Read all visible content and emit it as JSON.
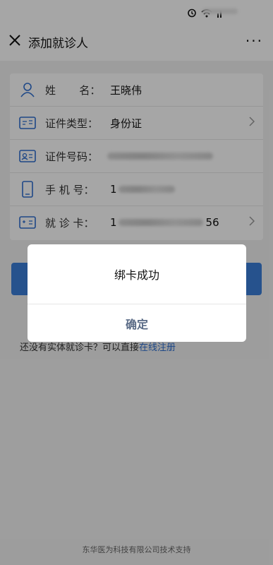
{
  "nav": {
    "title": "添加就诊人",
    "more": "···"
  },
  "form": {
    "name_label": "姓       名：",
    "name_value": "王晓伟",
    "id_type_label": "证件类型：",
    "id_type_value": "身份证",
    "id_no_label": "证件号码：",
    "phone_label": "手 机 号：",
    "phone_prefix": "1",
    "card_label": "就 诊 卡：",
    "card_prefix": "1",
    "card_suffix": "56"
  },
  "note": {
    "text": "还没有实体就诊卡？可以直接",
    "link": "在线注册"
  },
  "footer": {
    "text": "东华医为科技有限公司技术支持"
  },
  "dialog": {
    "message": "绑卡成功",
    "ok": "确定"
  },
  "colors": {
    "accent": "#3b7fd9",
    "link": "#2f6fd0",
    "icon": "#2f6fd0"
  }
}
